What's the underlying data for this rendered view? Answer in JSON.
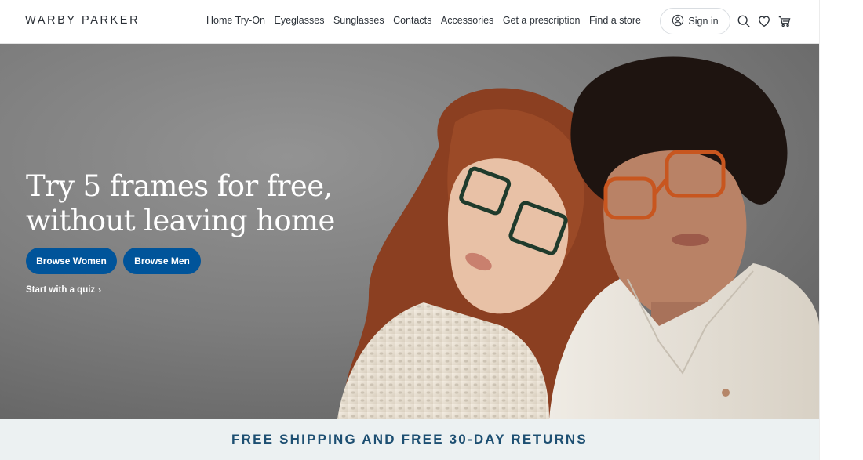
{
  "header": {
    "logo": "WARBY PARKER",
    "nav": [
      "Home Try-On",
      "Eyeglasses",
      "Sunglasses",
      "Contacts",
      "Accessories",
      "Get a prescription",
      "Find a store"
    ],
    "sign_in_label": "Sign in",
    "icons": [
      "user-icon",
      "search-icon",
      "heart-icon",
      "cart-icon"
    ]
  },
  "hero": {
    "title": "Try 5 frames for free,\nwithout leaving home",
    "primary_button": "Browse Women",
    "secondary_button": "Browse Men",
    "quiz_link": "Start with a quiz",
    "quiz_chevron": "›"
  },
  "banner": {
    "text": "FREE SHIPPING AND FREE 30-DAY RETURNS"
  },
  "colors": {
    "primary_blue": "#00549a",
    "banner_bg": "#ecf1f2",
    "banner_text": "#1d4f72",
    "hero_bg": "#7a7a7a"
  }
}
